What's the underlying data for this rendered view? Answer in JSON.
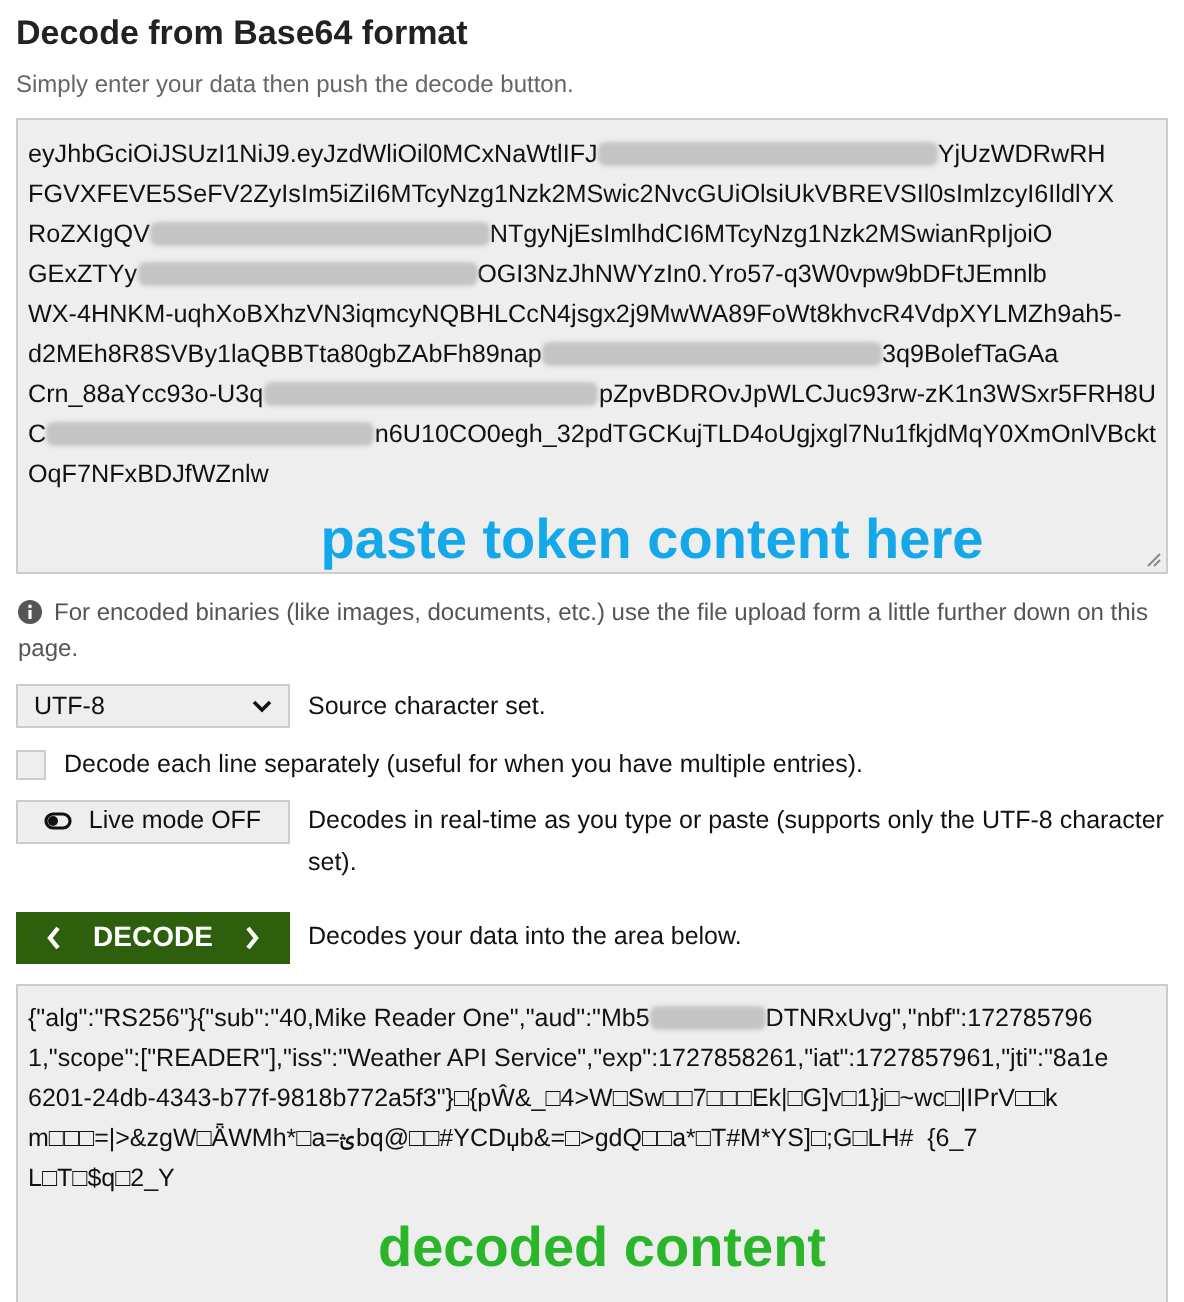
{
  "title": "Decode from Base64 format",
  "subtitle": "Simply enter your data then push the decode button.",
  "input": {
    "lines": [
      [
        {
          "kind": "text",
          "text": "eyJhbGciOiJSUzI1NiJ9.eyJzdWliOil0MCxNaWtlIFJ"
        },
        {
          "kind": "redacted"
        },
        {
          "kind": "text",
          "text": "YjUzWDRwRH"
        }
      ],
      [
        {
          "kind": "text",
          "text": "FGVXFEVE5SeFV2ZyIsIm5iZiI6MTcyNzg1Nzk2MSwic2NvcGUiOlsiUkVBREVSIl0sImlzcyI6IldlYX"
        }
      ],
      [
        {
          "kind": "text",
          "text": "RoZXIgQV"
        },
        {
          "kind": "redacted"
        },
        {
          "kind": "text",
          "text": "NTgyNjEsImlhdCI6MTcyNzg1Nzk2MSwianRpIjoiO"
        }
      ],
      [
        {
          "kind": "text",
          "text": "GExZTYy"
        },
        {
          "kind": "redacted"
        },
        {
          "kind": "text",
          "text": "OGI3NzJhNWYzIn0.Yro57-q3W0vpw9bDFtJEmnlb"
        }
      ],
      [
        {
          "kind": "text",
          "text": "WX-4HNKM-uqhXoBXhzVN3iqmcyNQBHLCcN4jsgx2j9MwWA89FoWt8khvcR4VdpXYLMZh9ah5-"
        }
      ],
      [
        {
          "kind": "text",
          "text": "d2MEh8R8SVBy1laQBBTta80gbZAbFh89nap"
        },
        {
          "kind": "redacted"
        },
        {
          "kind": "text",
          "text": "3q9BolefTaGAa"
        }
      ],
      [
        {
          "kind": "text",
          "text": "Crn_88aYcc93o-U3q"
        },
        {
          "kind": "redacted"
        },
        {
          "kind": "text",
          "text": "pZpvBDROvJpWLCJuc93rw-zK1n3WSxr5FRH8U"
        }
      ],
      [
        {
          "kind": "text",
          "text": "C"
        },
        {
          "kind": "redacted"
        },
        {
          "kind": "text",
          "text": "n6U10CO0egh_32pdTGCKujTLD4oUgjxgl7Nu1fkjdMqY0XmOnlVBckt"
        }
      ],
      [
        {
          "kind": "text",
          "text": "OqF7NFxBDJfWZnlw"
        }
      ]
    ],
    "annotation": "paste token content here"
  },
  "info": "For encoded binaries (like images, documents, etc.) use the file upload form a little further down on this page.",
  "charset": {
    "value": "UTF-8",
    "label": "Source character set."
  },
  "separate": {
    "checked": false,
    "label": "Decode each line separately (useful for when you have multiple entries)."
  },
  "live": {
    "on": false,
    "button": "Live mode OFF",
    "label": "Decodes in real-time as you type or paste (supports only the UTF-8 character set)."
  },
  "decode": {
    "button": "DECODE",
    "label": "Decodes your data into the area below."
  },
  "output": {
    "lines": [
      [
        {
          "kind": "text",
          "text": "{\"alg\":\"RS256\"}{\"sub\":\"40,Mike Reader One\",\"aud\":\"Mb5"
        },
        {
          "kind": "redacted_short"
        },
        {
          "kind": "text",
          "text": "DTNRxUvg\",\"nbf\":172785796"
        }
      ],
      [
        {
          "kind": "text",
          "text": "1,\"scope\":[\"READER\"],\"iss\":\"Weather API Service\",\"exp\":1727858261,\"iat\":1727857961,\"jti\":\"8a1e"
        }
      ],
      [
        {
          "kind": "text",
          "text": "6201-24db-4343-b77f-9818b772a5f3\"}□{pŴ&_□4>W□Sw□□7□□□Ek|□G]v□1}j□~wc□|IPrV□□k"
        }
      ],
      [
        {
          "kind": "text",
          "text": "m□□□=|>&zgW□ǞWMh*□a=ؿbq@□□#YCDџb&=□>gdQ□□a*□T#M*YS]□;G□LH#  {6_7"
        }
      ],
      [
        {
          "kind": "text",
          "text": "L□T□$q□2_Y"
        }
      ]
    ],
    "annotation": "decoded content"
  }
}
